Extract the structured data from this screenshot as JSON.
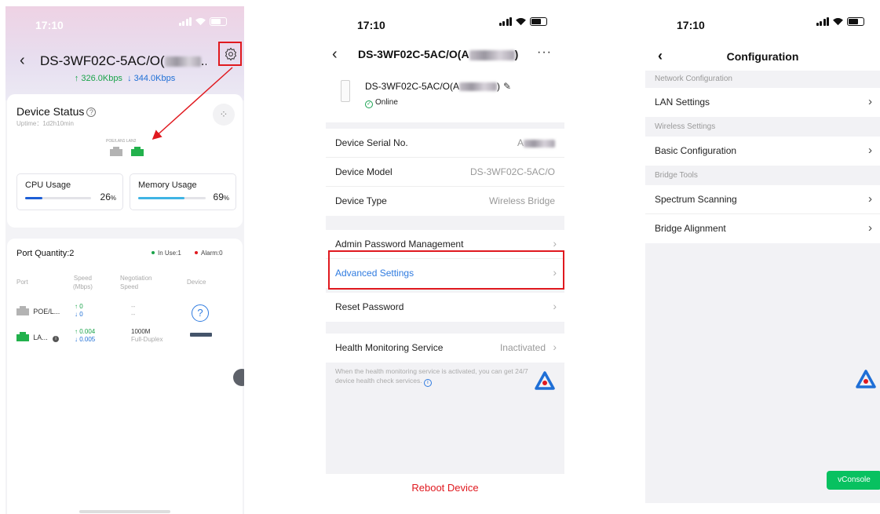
{
  "colors": {
    "accent_red": "#e0191f",
    "link_blue": "#2f7be0",
    "online_green": "#18a150",
    "console_green": "#08c160"
  },
  "screen1": {
    "status_time": "17:10",
    "title_prefix": "DS-3WF02C-5AC/O(",
    "upload_rate": "↑ 326.0Kbps",
    "download_rate": "↓ 344.0Kbps",
    "device_status_label": "Device Status",
    "uptime": "Uptime：1d2h10min",
    "port_labels": "POE/LAN1 LAN2",
    "cpu_label": "CPU Usage",
    "cpu_value": "26",
    "cpu_fraction": 0.26,
    "memory_label": "Memory Usage",
    "memory_value": "69",
    "memory_fraction": 0.69,
    "percent_sign": "%",
    "port_quantity": "Port Quantity:2",
    "in_use": "In Use:1",
    "alarm": "Alarm:0",
    "columns": {
      "port": "Port",
      "speed": "Speed",
      "speed_unit": "(Mbps)",
      "negotiation": "Negotiation",
      "negotiation_2": "Speed",
      "device": "Device"
    },
    "ports": [
      {
        "name": "POE/L...",
        "up": "↑ 0",
        "down": "↓ 0",
        "neg": "--",
        "neg2": "--"
      },
      {
        "name": "LA...",
        "up": "↑ 0.004",
        "down": "↓ 0.005",
        "neg": "1000M",
        "neg2": "Full-Duplex"
      }
    ],
    "help_glyph": "?"
  },
  "screen2": {
    "status_time": "17:10",
    "title_prefix": "DS-3WF02C-5AC/O(A",
    "title_suffix": ")",
    "more": "···",
    "device_name_prefix": "DS-3WF02C-5AC/O(A",
    "device_name_suffix": ")",
    "online": "Online",
    "info": [
      {
        "label": "Device Serial No.",
        "value": "A"
      },
      {
        "label": "Device Model",
        "value": "DS-3WF02C-5AC/O"
      },
      {
        "label": "Device Type",
        "value": "Wireless Bridge"
      }
    ],
    "admin_password": "Admin Password Management",
    "advanced_settings": "Advanced Settings",
    "reset_password": "Reset Password",
    "health_label": "Health Monitoring Service",
    "health_value": "Inactivated",
    "health_note": "When the health monitoring service is activated, you can get 24/7 device health check services.",
    "reboot": "Reboot Device"
  },
  "screen3": {
    "status_time": "17:10",
    "title": "Configuration",
    "sections": [
      {
        "header": "Network Configuration",
        "items": [
          "LAN Settings"
        ]
      },
      {
        "header": "Wireless Settings",
        "items": [
          "Basic Configuration"
        ]
      },
      {
        "header": "Bridge Tools",
        "items": [
          "Spectrum Scanning",
          "Bridge Alignment"
        ]
      }
    ],
    "vconsole": "vConsole"
  }
}
